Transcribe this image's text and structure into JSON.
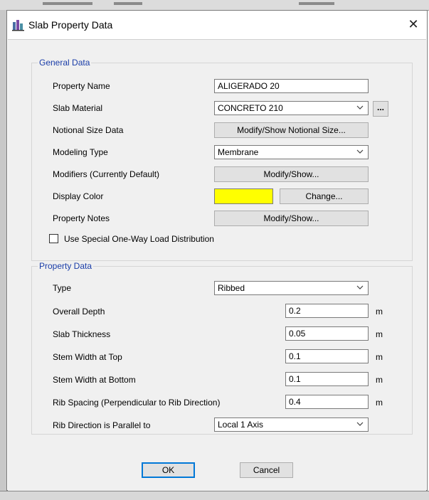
{
  "dialog": {
    "title": "Slab Property Data",
    "close_glyph": "✕"
  },
  "general": {
    "legend": "General Data",
    "property_name_label": "Property Name",
    "property_name_value": "ALIGERADO 20",
    "slab_material_label": "Slab Material",
    "slab_material_value": "CONCRETO 210",
    "material_more_label": "...",
    "notional_label": "Notional Size Data",
    "notional_button": "Modify/Show Notional Size...",
    "modeling_type_label": "Modeling Type",
    "modeling_type_value": "Membrane",
    "modifiers_label": "Modifiers (Currently Default)",
    "modifiers_button": "Modify/Show...",
    "display_color_label": "Display Color",
    "display_color_hex": "#ffff00",
    "change_button": "Change...",
    "notes_label": "Property Notes",
    "notes_button": "Modify/Show...",
    "one_way_checkbox_label": "Use Special One-Way Load Distribution",
    "one_way_checked": false
  },
  "property": {
    "legend": "Property Data",
    "type_label": "Type",
    "type_value": "Ribbed",
    "overall_depth_label": "Overall Depth",
    "overall_depth_value": "0.2",
    "slab_thickness_label": "Slab Thickness",
    "slab_thickness_value": "0.05",
    "stem_top_label": "Stem Width at Top",
    "stem_top_value": "0.1",
    "stem_bottom_label": "Stem Width at Bottom",
    "stem_bottom_value": "0.1",
    "rib_spacing_label": "Rib Spacing (Perpendicular to Rib Direction)",
    "rib_spacing_value": "0.4",
    "rib_direction_label": "Rib Direction is Parallel to",
    "rib_direction_value": "Local 1 Axis",
    "unit": "m"
  },
  "footer": {
    "ok_label": "OK",
    "cancel_label": "Cancel"
  },
  "colors": {
    "accent": "#0078d7",
    "legend_text": "#1a3da8",
    "background": "#f0f0f0"
  },
  "icons": [
    "app-icon",
    "close-icon",
    "chevron-down-icon",
    "checkbox-icon"
  ]
}
